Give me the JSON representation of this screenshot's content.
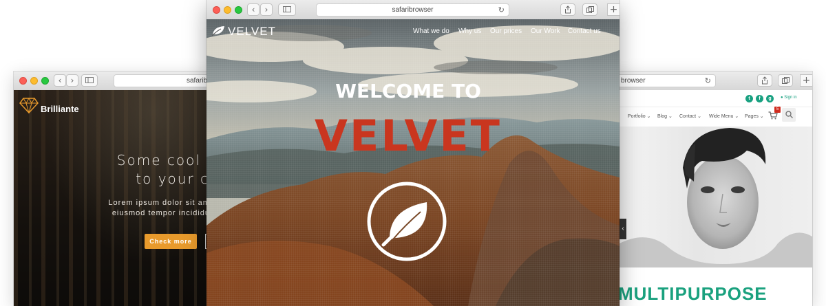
{
  "left_window": {
    "url": "safaribrowser",
    "brand": "Brilliante",
    "heading_line1": "Some cool mar",
    "heading_line2": "to your cu",
    "text_line1": "Lorem ipsum dolor sit amet, conse",
    "text_line2": "eiusmod tempor incididunt ut lab",
    "button_label": "Check more",
    "back_glyph": "‹",
    "forward_glyph": "›"
  },
  "center_window": {
    "url": "safaribrowser",
    "brand": "VELVET",
    "nav": [
      "What we do",
      "Why us",
      "Our prices",
      "Our Work",
      "Contact us"
    ],
    "welcome": "WELCOME TO",
    "big_title": "VELVET",
    "back_glyph": "‹",
    "forward_glyph": "›",
    "reload_glyph": "↻",
    "plus_glyph": "+"
  },
  "right_window": {
    "url": "browser",
    "social": [
      "t",
      "f",
      "g"
    ],
    "signin": "Sign in",
    "menu": [
      "Portfolio",
      "Blog",
      "Contact",
      "Wide Menu",
      "Pages"
    ],
    "cart_badge": "5",
    "title": "MULTIPURPOSE",
    "reload_glyph": "↻",
    "plus_glyph": "+",
    "arrow_glyph": "‹"
  },
  "colors": {
    "accent_orange": "#e89a2c",
    "velvet_red": "#c9361f",
    "green": "#1aa17e"
  }
}
